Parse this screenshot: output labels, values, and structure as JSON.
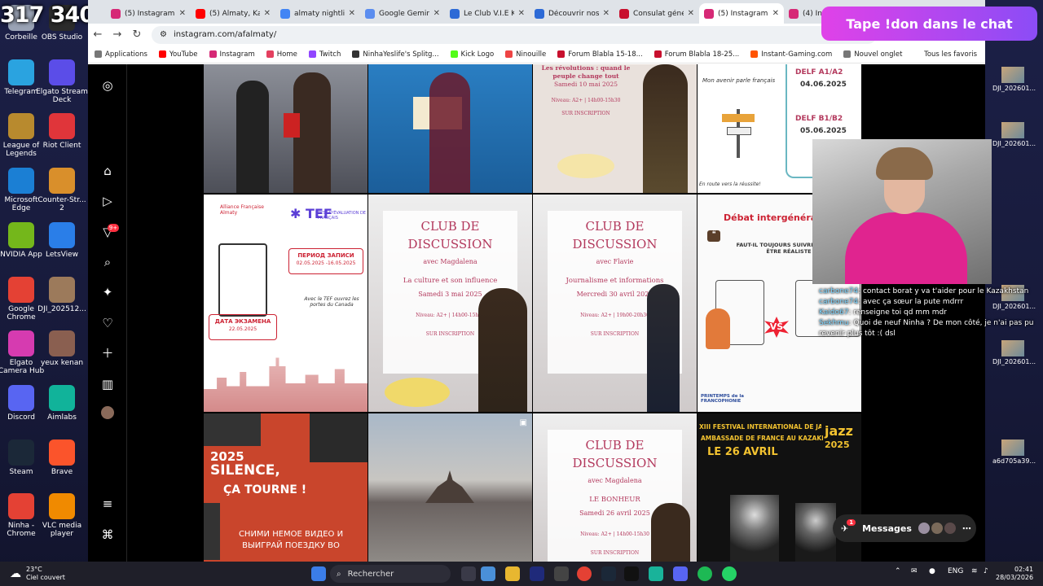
{
  "overlay": {
    "counter": "317 340",
    "don_banner": "Tape !don dans le chat"
  },
  "desktop": {
    "left_icons": [
      {
        "label": "Corbeille",
        "color": "#9aa3b5"
      },
      {
        "label": "OBS Studio",
        "color": "#2b2b2b"
      },
      {
        "label": "Telegram",
        "color": "#2aa3e0"
      },
      {
        "label": "Elgato Stream Deck",
        "color": "#5b4de8"
      },
      {
        "label": "League of Legends",
        "color": "#b88a2e"
      },
      {
        "label": "Riot Client",
        "color": "#e0353a"
      },
      {
        "label": "Microsoft Edge",
        "color": "#1b7fd4"
      },
      {
        "label": "Counter-Str... 2",
        "color": "#d98f2b"
      },
      {
        "label": "NVIDIA App",
        "color": "#74b71b"
      },
      {
        "label": "LetsView",
        "color": "#2a7ee8"
      },
      {
        "label": "Google Chrome",
        "color": "#e44134"
      },
      {
        "label": "DJI_202512...",
        "color": "#9c7a5b"
      },
      {
        "label": "Elgato Camera Hub",
        "color": "#d63bb0"
      },
      {
        "label": "yeux kenan",
        "color": "#8a5f50"
      },
      {
        "label": "Discord",
        "color": "#5865f2"
      },
      {
        "label": "Aimlabs",
        "color": "#11b39a"
      },
      {
        "label": "Steam",
        "color": "#1b2838"
      },
      {
        "label": "Brave",
        "color": "#fb542b"
      },
      {
        "label": "Ninha - Chrome",
        "color": "#e44134"
      },
      {
        "label": "VLC media player",
        "color": "#f08a00"
      }
    ],
    "right_icons": [
      "DJI_202601...",
      "DJI_202601...",
      "DJI_202601...",
      "DJI_202601...",
      "a6d705a39..."
    ]
  },
  "browser": {
    "tabs": [
      {
        "title": "(5) Instagram",
        "fav": "#d62976",
        "active": false
      },
      {
        "title": "(5) Almaty, Kaza",
        "fav": "#ff0000",
        "active": false
      },
      {
        "title": "almaty nightlife",
        "fav": "#4285f4",
        "active": false
      },
      {
        "title": "Google Gemini",
        "fav": "#5b8def",
        "active": false
      },
      {
        "title": "Le Club V.I.E Ka",
        "fav": "#2d6ad6",
        "active": false
      },
      {
        "title": "Découvrir nos",
        "fav": "#2d6ad6",
        "active": false
      },
      {
        "title": "Consulat génér",
        "fav": "#c8102e",
        "active": false
      },
      {
        "title": "(5) Instagram",
        "fav": "#d62976",
        "active": true
      },
      {
        "title": "(4) Insta",
        "fav": "#d62976",
        "active": false
      }
    ],
    "url": "instagram.com/afalmaty/",
    "bookmarks": [
      {
        "label": "Applications",
        "color": "#777"
      },
      {
        "label": "YouTube",
        "color": "#ff0000"
      },
      {
        "label": "Instagram",
        "color": "#d62976"
      },
      {
        "label": "Home",
        "color": "#e4405f"
      },
      {
        "label": "Twitch",
        "color": "#9146ff"
      },
      {
        "label": "NinhaYeslife's Splitg...",
        "color": "#333"
      },
      {
        "label": "Kick Logo",
        "color": "#53fc18"
      },
      {
        "label": "Ninouille",
        "color": "#e44"
      },
      {
        "label": "Forum Blabla 15-18...",
        "color": "#c8102e"
      },
      {
        "label": "Forum Blabla 18-25...",
        "color": "#c8102e"
      },
      {
        "label": "Instant-Gaming.com",
        "color": "#ff5400"
      },
      {
        "label": "Nouvel onglet",
        "color": "#777"
      }
    ],
    "bookmarks_right": "Tous les favoris"
  },
  "instagram": {
    "notif_badge": "9+",
    "posts": {
      "r1c3": {
        "title": "Les révolutions : quand le peuple change tout",
        "date": "Samedi 10 mai 2025",
        "info": "Niveau: A2+ | 14h00-15h30",
        "reg": "SUR INSCRIPTION"
      },
      "r1c4": {
        "heading": "Mon avenir parle français",
        "delf1": "DELF A1/A2",
        "date1": "04.06.2025",
        "delf2": "DELF B1/B2",
        "date2": "05.06.2025",
        "footer": "En route vers la réussite!"
      },
      "r2c1": {
        "brand": "Alliance Française Almaty",
        "tef": "TEF",
        "tef_sub": "TEST D'ÉVALUATION DE FRANÇAIS",
        "period_label": "ПЕРИОД ЗАПИСИ",
        "period": "02.05.2025 -16.05.2025",
        "slogan": "Avec le TEF ouvrez les portes du Canada",
        "exam_label": "ДАТА ЭКЗАМЕНА",
        "exam_date": "22.05.2025"
      },
      "r2c2": {
        "title": "CLUB DE DISCUSSION",
        "host": "avec Magdalena",
        "topic": "La culture et son influence",
        "date": "Samedi 3 mai 2025",
        "info": "Niveau: A2+ | 14h00-15h30",
        "reg": "SUR INSCRIPTION"
      },
      "r2c3": {
        "title": "CLUB DE DISCUSSION",
        "host": "avec Flavie",
        "topic": "Journalisme et informations",
        "date": "Mercredi 30 avril 2025",
        "info": "Niveau: A2+ | 19h00-20h30",
        "reg": "SUR INSCRIPTION"
      },
      "r2c4": {
        "title": "Débat intergénératio",
        "question": "FAUT-IL TOUJOURS SUIVRE SES ... OU ÊTRE RÉALISTE ?",
        "vs": "VS",
        "footer": "PRINTEMPS de la FRANCOPHONIE"
      },
      "r3c1": {
        "year": "2025",
        "line1": "SILENCE,",
        "line2": "ÇA TOURNE !",
        "ru": "СНИМИ НЕМОЕ ВИДЕО И ВЫИГРАЙ ПОЕЗДКУ ВО"
      },
      "r3c3": {
        "title": "CLUB DE DISCUSSION",
        "host": "avec Magdalena",
        "topic": "LE BONHEUR",
        "date": "Samedi 26 avril 2025",
        "info": "Niveau: A2+ | 14h00-15h30",
        "reg": "SUR INSCRIPTION"
      },
      "r3c4": {
        "line1": "XIII FESTIVAL INTERNATIONAL DE JAZZ ALMATY",
        "line2": "AMBASSADE DE FRANCE AU KAZAKHSTAN",
        "date": "LE 26 AVRIL",
        "jazz": "jazz",
        "year": "2025"
      }
    },
    "messages": {
      "label": "Messages",
      "badge": "1"
    }
  },
  "chat": [
    {
      "user": "carbone74",
      "msg": "contact borat y va t'aider pour le Kazakhstan"
    },
    {
      "user": "carbone74",
      "msg": "avec ça sœur la pute mdrrr"
    },
    {
      "user": "Kaido67",
      "msg": "renseigne toi qd mm mdr"
    },
    {
      "user": "Sekhmu",
      "msg": "Quoi de neuf Ninha ? De mon côté, je n'ai pas pu revenir plus tôt :( dsl"
    }
  ],
  "taskbar": {
    "weather_temp": "23°C",
    "weather_desc": "Ciel couvert",
    "search_placeholder": "Rechercher",
    "lang": "ENG",
    "time": "02:41",
    "date": "28/03/2026"
  }
}
